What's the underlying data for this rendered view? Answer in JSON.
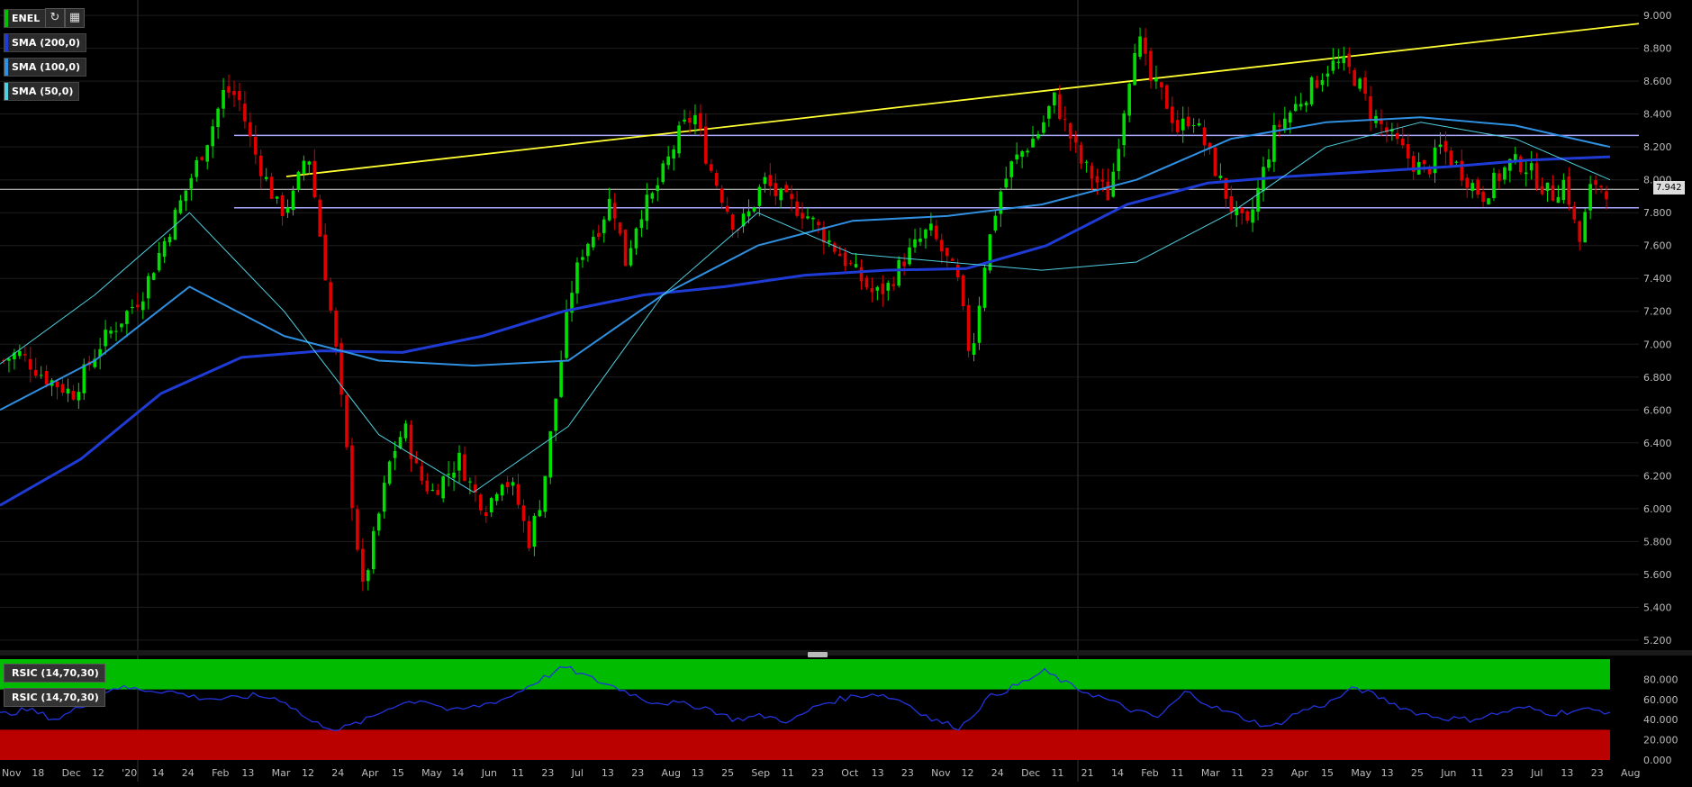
{
  "symbol": "ENEL",
  "toolbar": {
    "refresh_icon": "refresh-icon",
    "settings_icon": "bars-icon"
  },
  "price_panel": {
    "indicators": [
      {
        "label": "SMA (200,0)",
        "color": "#1f3bd6"
      },
      {
        "label": "SMA (100,0)",
        "color": "#2f8fe0"
      },
      {
        "label": "SMA (50,0)",
        "color": "#4fd0e0"
      }
    ],
    "last_price": "7.942",
    "y_ticks": [
      "9.000",
      "8.800",
      "8.600",
      "8.400",
      "8.200",
      "8.000",
      "7.800",
      "7.600",
      "7.400",
      "7.200",
      "7.000",
      "6.800",
      "6.600",
      "6.400",
      "6.200",
      "6.000",
      "5.800",
      "5.600",
      "5.400",
      "5.200"
    ]
  },
  "rsi_panel": {
    "labels": [
      "RSIC (14,70,30)",
      "RSIC (14,70,30)"
    ],
    "y_ticks": [
      "80.000",
      "60.000",
      "40.000",
      "20.000",
      "0.000"
    ],
    "overbought": 70,
    "oversold": 30,
    "zone_colors": {
      "overbought": "#00bb00",
      "oversold": "#bb0000"
    }
  },
  "x_ticks": [
    "Nov",
    "18",
    "Dec",
    "12",
    "'20",
    "14",
    "24",
    "Feb",
    "13",
    "Mar",
    "12",
    "24",
    "Apr",
    "15",
    "May",
    "14",
    "Jun",
    "11",
    "23",
    "Jul",
    "13",
    "23",
    "Aug",
    "13",
    "25",
    "Sep",
    "11",
    "23",
    "Oct",
    "13",
    "23",
    "Nov",
    "12",
    "24",
    "Dec",
    "11",
    "21",
    "14",
    "Feb",
    "11",
    "Mar",
    "11",
    "23",
    "Apr",
    "15",
    "May",
    "13",
    "25",
    "Jun",
    "11",
    "23",
    "Jul",
    "13",
    "23",
    "Aug"
  ],
  "chart_data": {
    "type": "candlestick",
    "y_range": [
      5.15,
      9.05
    ],
    "colors": {
      "up": "#00e000",
      "down": "#e00000",
      "sma200": "#1f3bd6",
      "sma100": "#2f8fe0",
      "sma50": "#4fd0e0",
      "trendline": "#ffff33",
      "levels": "#a8a8ff",
      "last_price_line": "#dddddd"
    },
    "horizontal_levels": [
      8.27,
      7.83
    ],
    "trendline": {
      "from": 8.02,
      "to": 8.95
    },
    "last_price": 7.942,
    "close_series": [
      6.9,
      6.95,
      6.88,
      6.8,
      6.75,
      6.7,
      6.85,
      7.0,
      7.1,
      7.2,
      7.3,
      7.5,
      7.7,
      7.9,
      8.1,
      8.3,
      8.55,
      8.5,
      8.2,
      8.0,
      7.8,
      7.9,
      8.2,
      7.6,
      7.0,
      6.2,
      5.5,
      5.9,
      6.3,
      6.5,
      6.2,
      6.1,
      6.2,
      6.3,
      6.1,
      6.0,
      6.2,
      6.1,
      5.8,
      6.1,
      6.7,
      7.3,
      7.6,
      7.7,
      7.9,
      7.5,
      7.8,
      7.9,
      8.1,
      8.3,
      8.4,
      8.1,
      7.9,
      7.7,
      7.8,
      8.0,
      7.9,
      7.85,
      7.8,
      7.7,
      7.6,
      7.5,
      7.4,
      7.3,
      7.35,
      7.5,
      7.6,
      7.7,
      7.55,
      7.4,
      6.9,
      7.5,
      7.9,
      8.1,
      8.2,
      8.3,
      8.5,
      8.3,
      8.1,
      8.0,
      7.9,
      8.4,
      8.9,
      8.6,
      8.5,
      8.3,
      8.4,
      8.2,
      8.0,
      7.8,
      7.7,
      8.0,
      8.3,
      8.4,
      8.5,
      8.6,
      8.7,
      8.7,
      8.6,
      8.4,
      8.3,
      8.2,
      8.1,
      8.05,
      8.2,
      8.1,
      8.0,
      7.9,
      8.0,
      8.1,
      8.1,
      8.0,
      7.9,
      8.0,
      7.6,
      8.0,
      7.94
    ],
    "sma200": [
      6.02,
      6.3,
      6.7,
      6.92,
      6.96,
      6.95,
      7.05,
      7.2,
      7.3,
      7.35,
      7.42,
      7.45,
      7.46,
      7.6,
      7.85,
      7.98,
      8.02,
      8.05,
      8.08,
      8.12,
      8.14
    ],
    "sma100": [
      6.6,
      6.9,
      7.35,
      7.05,
      6.9,
      6.87,
      6.9,
      7.3,
      7.6,
      7.75,
      7.78,
      7.85,
      8.0,
      8.25,
      8.35,
      8.38,
      8.33,
      8.2
    ],
    "sma50": [
      6.88,
      7.3,
      7.8,
      7.2,
      6.45,
      6.1,
      6.5,
      7.3,
      7.8,
      7.55,
      7.5,
      7.45,
      7.5,
      7.8,
      8.2,
      8.35,
      8.25,
      8.0
    ],
    "rsi_series": [
      45,
      50,
      40,
      55,
      72,
      70,
      68,
      62,
      60,
      64,
      60,
      38,
      30,
      40,
      55,
      60,
      48,
      54,
      62,
      78,
      92,
      80,
      70,
      58,
      56,
      52,
      40,
      44,
      38,
      55,
      62,
      66,
      58,
      40,
      32,
      62,
      74,
      88,
      72,
      62,
      50,
      42,
      68,
      52,
      42,
      32,
      48,
      56,
      72,
      60,
      48,
      42,
      40,
      46,
      52,
      46,
      50,
      48
    ]
  }
}
